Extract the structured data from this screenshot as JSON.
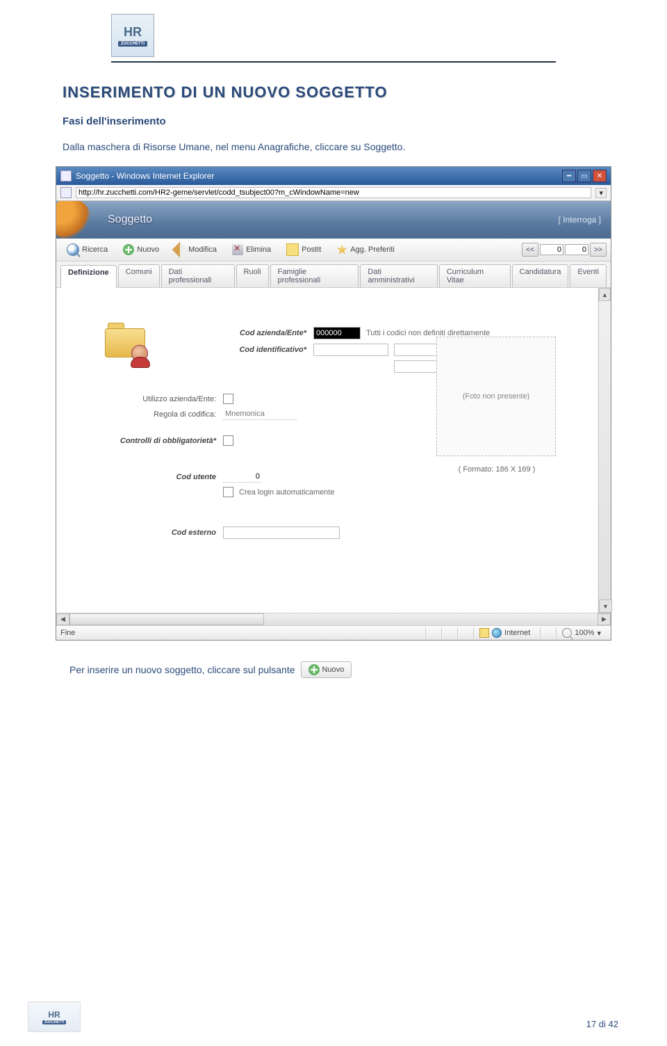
{
  "doc": {
    "title": "INSERIMENTO DI UN NUOVO SOGGETTO",
    "subtitle": "Fasi dell'inserimento",
    "intro": "Dalla maschera di Risorse Umane, nel menu Anagrafiche, cliccare su Soggetto.",
    "aftertext": "Per inserire un nuovo soggetto, cliccare sul pulsante",
    "nuovo_label": "Nuovo",
    "pagelabel": "17 di 42",
    "logo_main": "HR",
    "logo_sub": "ZUCCHETTI"
  },
  "browser": {
    "window_title": "Soggetto - Windows Internet Explorer",
    "url": "http://hr.zucchetti.com/HR2-geme/servlet/codd_tsubject00?m_cWindowName=new",
    "status_left": "Fine",
    "zone_label": "Internet",
    "zoom_label": "100%"
  },
  "app": {
    "title": "Soggetto",
    "mode": "[ Interroga ]"
  },
  "toolbar": {
    "ricerca": "Ricerca",
    "nuovo": "Nuovo",
    "modifica": "Modifica",
    "elimina": "Elimina",
    "postit": "PostIt",
    "preferiti": "Agg. Preferiti",
    "pager_prev": "<<",
    "pager_next": ">>",
    "pager_cur": "0",
    "pager_tot": "0"
  },
  "tabs": [
    "Definizione",
    "Comuni",
    "Dati professionali",
    "Ruoli",
    "Famiglie professionali",
    "Dati amministrativi",
    "Curriculum Vitae",
    "Candidatura",
    "Eventi"
  ],
  "form": {
    "cod_azienda_label": "Cod azienda/Ente*",
    "cod_azienda_value": "000000",
    "cod_azienda_note": "Tutti i codici non definiti direttamente",
    "cod_ident_label": "Cod identificativo*",
    "utilizzo_label": "Utilizzo azienda/Ente:",
    "regola_label": "Regola di codifica:",
    "regola_value": "Mnemonica",
    "controlli_label": "Controlli di obbligatorietà*",
    "cod_utente_label": "Cod utente",
    "cod_utente_value": "0",
    "crea_login_label": "Crea login automaticamente",
    "cod_esterno_label": "Cod esterno",
    "photo_placeholder": "(Foto non presente)",
    "photo_format": "( Formato: 186 X 169 )"
  }
}
